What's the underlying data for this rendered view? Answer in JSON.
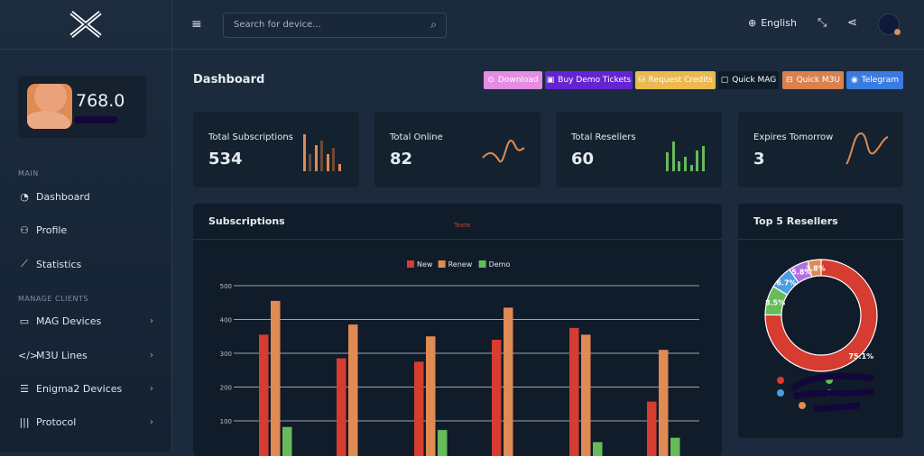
{
  "header": {
    "search_placeholder": "Search for device...",
    "language": "English"
  },
  "sidebar": {
    "credits": "768.0",
    "sections": [
      {
        "title": "MAIN"
      },
      {
        "title": "MANAGE CLIENTS"
      }
    ],
    "items": [
      {
        "label": "Dashboard",
        "icon": "gauge-icon"
      },
      {
        "label": "Profile",
        "icon": "user-icon"
      },
      {
        "label": "Statistics",
        "icon": "chart-line-icon"
      },
      {
        "label": "MAG Devices",
        "icon": "monitor-icon"
      },
      {
        "label": "M3U Lines",
        "icon": "code-icon"
      },
      {
        "label": "Enigma2 Devices",
        "icon": "server-icon"
      },
      {
        "label": "Protocol",
        "icon": "barcode-icon"
      }
    ]
  },
  "page": {
    "title": "Dashboard"
  },
  "actions": [
    {
      "label": "Download",
      "color": "#e58ce3"
    },
    {
      "label": "Buy Demo Tickets",
      "color": "#6424d1"
    },
    {
      "label": "Request Credits",
      "color": "#eab94f"
    },
    {
      "label": "Quick MAG",
      "color": "#0f1d2a"
    },
    {
      "label": "Quick M3U",
      "color": "#d9824f"
    },
    {
      "label": "Telegram",
      "color": "#3b7be0"
    }
  ],
  "stats": [
    {
      "label": "Total Subscriptions",
      "value": "534"
    },
    {
      "label": "Total Online",
      "value": "82"
    },
    {
      "label": "Total Resellers",
      "value": "60"
    },
    {
      "label": "Expires Tomorrow",
      "value": "3"
    }
  ],
  "subscriptions": {
    "title": "Subscriptions",
    "overlay_text": "Texte"
  },
  "resellers": {
    "title": "Top 5 Resellers"
  },
  "chart_data": [
    {
      "type": "bar",
      "title": "",
      "ylim": [
        0,
        500
      ],
      "yticks": [
        100,
        200,
        300,
        400,
        500
      ],
      "grid": true,
      "legend": "top",
      "series": [
        {
          "name": "New",
          "color": "#d63c2f",
          "values": [
            355,
            285,
            275,
            340,
            375,
            157
          ]
        },
        {
          "name": "Renew",
          "color": "#e08a54",
          "values": [
            455,
            385,
            350,
            435,
            355,
            310
          ]
        },
        {
          "name": "Demo",
          "color": "#66bb5a",
          "values": [
            82,
            0,
            73,
            0,
            37,
            50
          ]
        }
      ]
    },
    {
      "type": "pie",
      "donut": true,
      "legend": "bottom",
      "values": [
        75.1,
        8.5,
        6.7,
        5.8,
        3.8
      ],
      "labels": [
        "75.1%",
        "8.5%",
        "6.7%",
        "5.8%",
        "3.8%"
      ],
      "colors": [
        "#d63c2f",
        "#66bb5a",
        "#4a9ee0",
        "#b36ee0",
        "#e08a54"
      ]
    }
  ]
}
